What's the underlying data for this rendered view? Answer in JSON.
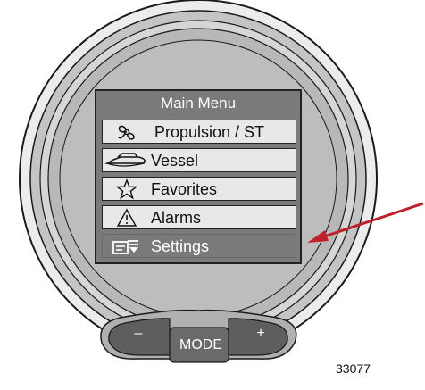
{
  "screen": {
    "title": "Main Menu",
    "items": [
      {
        "label": "Propulsion / ST",
        "icon": "propeller-icon",
        "selected": false
      },
      {
        "label": "Vessel",
        "icon": "boat-icon",
        "selected": false
      },
      {
        "label": "Favorites",
        "icon": "star-icon",
        "selected": false
      },
      {
        "label": "Alarms",
        "icon": "warning-triangle-icon",
        "selected": false
      },
      {
        "label": "Settings",
        "icon": "settings-menu-icon",
        "selected": true
      }
    ]
  },
  "buttons": {
    "minus": "–",
    "mode": "MODE",
    "plus": "+"
  },
  "figure_number": "33077",
  "colors": {
    "highlight": "#7a7a7a",
    "item_bg": "#e8e8e8",
    "pointer": "#c0202b"
  }
}
